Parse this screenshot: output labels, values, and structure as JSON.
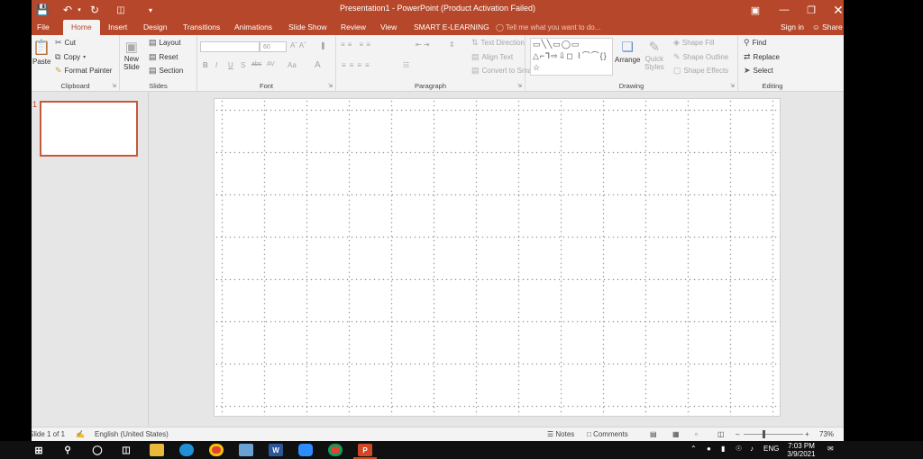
{
  "window": {
    "title": "Presentation1 - PowerPoint (Product Activation Failed)",
    "qat": {
      "save_icon": "save-icon",
      "undo_icon": "undo-icon",
      "redo_icon": "redo-icon",
      "present_icon": "start-from-beginning-icon",
      "customize_icon": "customize-qat-icon"
    },
    "controls": {
      "ribbon_display": "ribbon-display-options-icon",
      "minimize": "minimize-icon",
      "restore": "restore-icon",
      "close": "close-icon"
    }
  },
  "tabs": {
    "items": [
      "File",
      "Home",
      "Insert",
      "Design",
      "Transitions",
      "Animations",
      "Slide Show",
      "Review",
      "View",
      "SMART E-LEARNING"
    ],
    "active": "Home",
    "tell_me": "Tell me what you want to do...",
    "sign_in": "Sign in",
    "share": "Share"
  },
  "ribbon": {
    "clipboard": {
      "label": "Clipboard",
      "paste": "Paste",
      "cut": "Cut",
      "copy": "Copy",
      "format_painter": "Format Painter"
    },
    "slides": {
      "label": "Slides",
      "new_slide_1": "New",
      "new_slide_2": "Slide",
      "layout": "Layout",
      "reset": "Reset",
      "section": "Section"
    },
    "font": {
      "label": "Font",
      "font_name": "",
      "font_size": "60",
      "bold": "B",
      "italic": "I",
      "underline": "U",
      "shadow": "S",
      "strike": "abc",
      "spacing": "AV",
      "change_case": "Aa",
      "font_color": "A"
    },
    "paragraph": {
      "label": "Paragraph",
      "text_direction": "Text Direction",
      "align_text": "Align Text",
      "convert_smartart": "Convert to SmartArt"
    },
    "drawing": {
      "label": "Drawing",
      "arrange": "Arrange",
      "quick_styles_1": "Quick",
      "quick_styles_2": "Styles",
      "shape_fill": "Shape Fill",
      "shape_outline": "Shape Outline",
      "shape_effects": "Shape Effects",
      "shapes_glyphs": "▭╲╲▭◯▭ △⌐⅂⇨⇩◻ ⌇⌒⌒{}☆"
    },
    "editing": {
      "label": "Editing",
      "find": "Find",
      "replace": "Replace",
      "select": "Select"
    }
  },
  "thumbnails": {
    "slide_number": "1"
  },
  "status": {
    "slide_of": "Slide 1 of 1",
    "language": "English (United States)",
    "notes": "Notes",
    "comments": "Comments",
    "zoom": "73%"
  },
  "taskbar": {
    "apps": [
      "windows-start-icon",
      "search-icon",
      "task-view-icon",
      "file-explorer-icon",
      "edge-icon",
      "chrome-icon",
      "app-icon",
      "word-icon",
      "zoom-icon",
      "chrome-icon",
      "powerpoint-icon"
    ],
    "word_letter": "W",
    "ppt_letter": "P",
    "tray_lang": "ENG",
    "time": "7:03 PM",
    "date": "3/9/2021"
  },
  "colors": {
    "accent": "#b7472a",
    "ribbon_bg": "#f3f3f3",
    "workspace": "#e6e6e6",
    "taskbar": "#101010"
  }
}
